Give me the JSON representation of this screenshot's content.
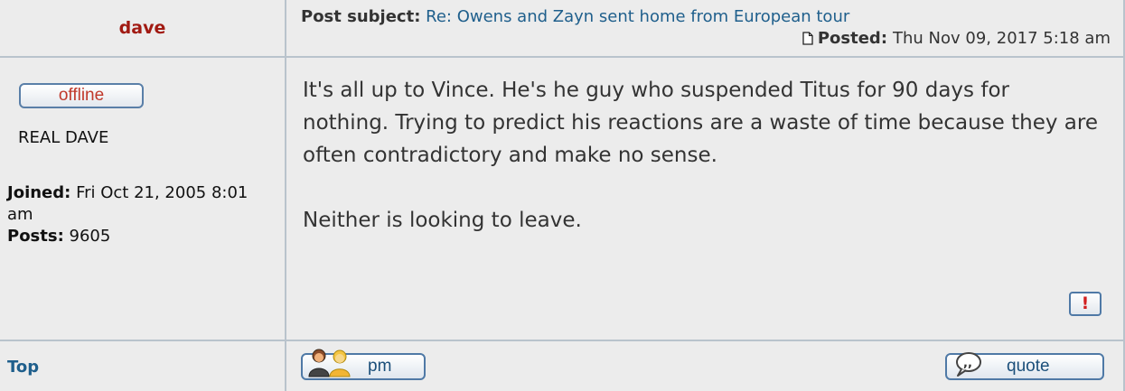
{
  "author": {
    "name": "dave",
    "status": "offline",
    "rank": "REAL DAVE",
    "joined_label": "Joined:",
    "joined_value": "Fri Oct 21, 2005 8:01 am",
    "posts_label": "Posts:",
    "posts_value": "9605"
  },
  "post": {
    "subject_label": "Post subject:",
    "subject": "Re: Owens and Zayn sent home from European tour",
    "posted_label": "Posted:",
    "posted_value": "Thu Nov 09, 2017 5:18 am",
    "paragraphs": [
      "It's all up to Vince. He's he guy who suspended Titus for 90 days for nothing. Trying to predict his reactions are a waste of time because they are often contradictory and make no sense.",
      "Neither is looking to leave."
    ],
    "report_symbol": "!"
  },
  "footer": {
    "top_link": "Top",
    "pm_label": "pm",
    "quote_label": "quote"
  },
  "colors": {
    "author_name": "#a11a12",
    "link": "#1f5f8c",
    "border": "#b9c3cc",
    "offline": "#c0392b"
  },
  "icons": {
    "posted": "page-icon",
    "report": "exclamation-icon",
    "pm": "two-people-icon",
    "quote": "speech-bubble-icon"
  }
}
